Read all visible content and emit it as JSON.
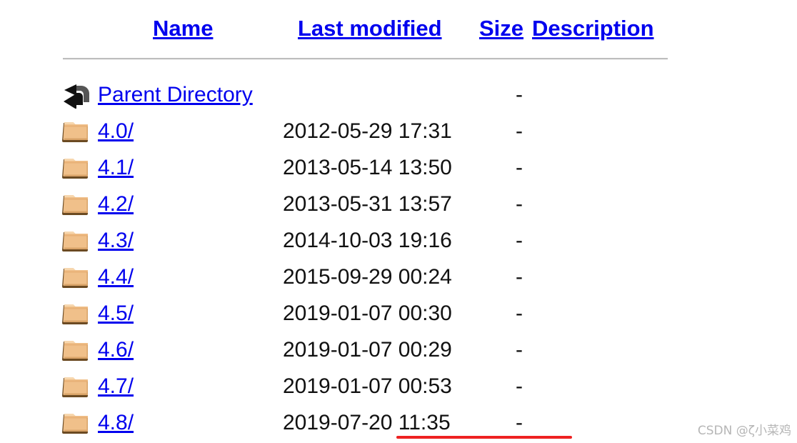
{
  "page": {
    "background_color": "#ffffff",
    "link_color": "#0000ee",
    "text_color": "#111111"
  },
  "header": {
    "columns": [
      {
        "label": "Name",
        "icon": "column-sort-name"
      },
      {
        "label": "Last modified",
        "icon": "column-sort-lastmodified"
      },
      {
        "label": "Size",
        "icon": "column-sort-size"
      },
      {
        "label": "Description",
        "icon": "column-sort-description"
      }
    ]
  },
  "listing": {
    "rows": [
      {
        "icon": "back-arrow-icon",
        "name": "Parent Directory",
        "last_modified": "",
        "size": "-",
        "description": ""
      },
      {
        "icon": "folder-icon",
        "name": "4.0/",
        "last_modified": "2012-05-29 17:31",
        "size": "-",
        "description": ""
      },
      {
        "icon": "folder-icon",
        "name": "4.1/",
        "last_modified": "2013-05-14 13:50",
        "size": "-",
        "description": ""
      },
      {
        "icon": "folder-icon",
        "name": "4.2/",
        "last_modified": "2013-05-31 13:57",
        "size": "-",
        "description": ""
      },
      {
        "icon": "folder-icon",
        "name": "4.3/",
        "last_modified": "2014-10-03 19:16",
        "size": "-",
        "description": ""
      },
      {
        "icon": "folder-icon",
        "name": "4.4/",
        "last_modified": "2015-09-29 00:24",
        "size": "-",
        "description": ""
      },
      {
        "icon": "folder-icon",
        "name": "4.5/",
        "last_modified": "2019-01-07 00:30",
        "size": "-",
        "description": ""
      },
      {
        "icon": "folder-icon",
        "name": "4.6/",
        "last_modified": "2019-01-07 00:29",
        "size": "-",
        "description": ""
      },
      {
        "icon": "folder-icon",
        "name": "4.7/",
        "last_modified": "2019-01-07 00:53",
        "size": "-",
        "description": ""
      },
      {
        "icon": "folder-icon",
        "name": "4.8/",
        "last_modified": "2019-07-20 11:35",
        "size": "-",
        "description": ""
      }
    ]
  },
  "annotations": {
    "red_underline_color": "#ee2222",
    "watermark": "CSDN @ζ小菜鸡"
  }
}
